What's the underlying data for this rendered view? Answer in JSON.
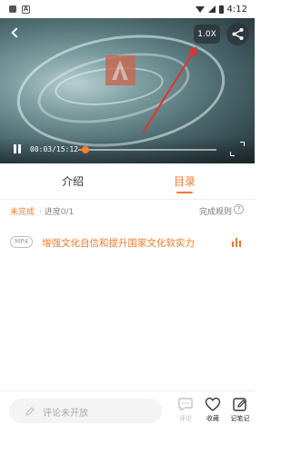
{
  "status_bar": {
    "time": "4:12"
  },
  "player": {
    "speed_label": "1.0X",
    "current_time": "00:03",
    "duration": "15:12",
    "time_display": "00:03/15:12",
    "progress_fraction": 0.003,
    "icons": [
      "back-icon",
      "share-icon",
      "pause-icon",
      "fullscreen-icon"
    ],
    "accent_color": "#ff7f2a"
  },
  "tabs": [
    {
      "label": "介绍",
      "active": false
    },
    {
      "label": "目录",
      "active": true
    }
  ],
  "progress": {
    "status": "未完成",
    "detail": "· 进度0/1",
    "rules_label": "完成规则",
    "help_symbol": "?"
  },
  "lessons": [
    {
      "format": "MP4",
      "title": "增强文化自信和提升国家文化软实力",
      "playing": true
    }
  ],
  "bottom_bar": {
    "comment_placeholder": "评论未开放",
    "actions": [
      {
        "label": "评论",
        "icon": "comment-icon",
        "enabled": false
      },
      {
        "label": "收藏",
        "icon": "heart-icon",
        "enabled": true
      },
      {
        "label": "记笔记",
        "icon": "note-icon",
        "enabled": true
      }
    ]
  },
  "colors": {
    "accent": "#f07a2b",
    "annotation_arrow": "#e5322d"
  }
}
